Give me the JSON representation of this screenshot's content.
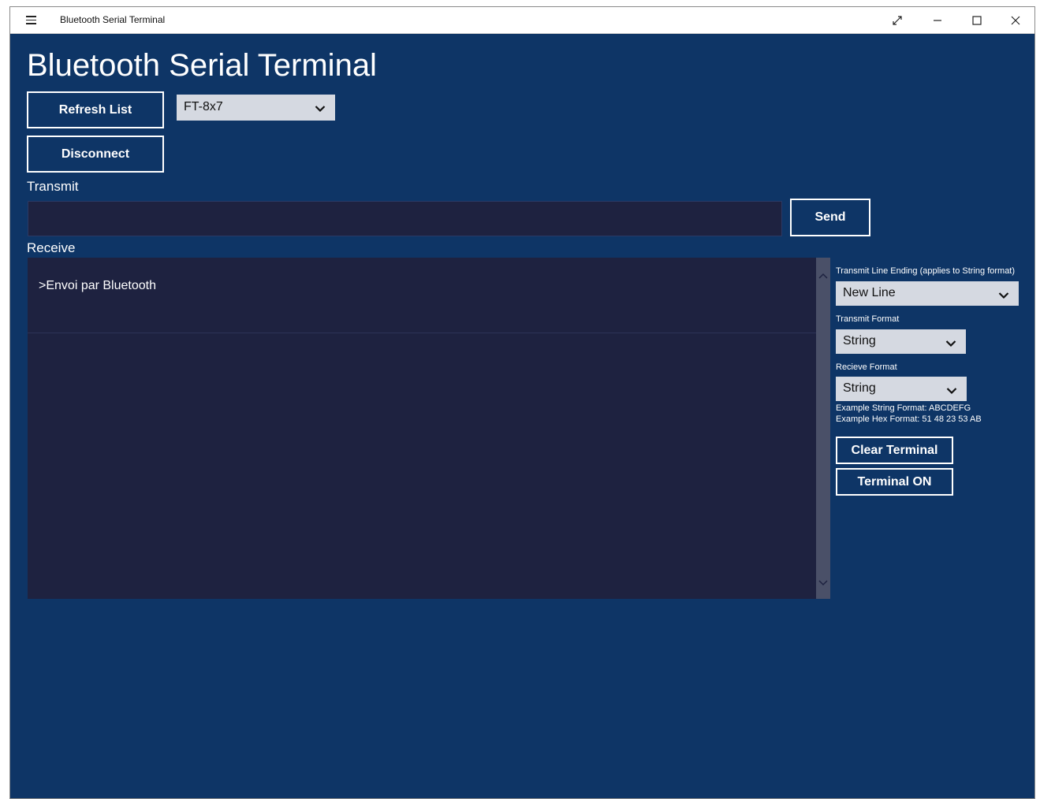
{
  "window": {
    "title": "Bluetooth Serial Terminal"
  },
  "app": {
    "heading": "Bluetooth Serial Terminal"
  },
  "device": {
    "refresh_label": "Refresh List",
    "disconnect_label": "Disconnect",
    "selected": "FT-8x7"
  },
  "transmit": {
    "label": "Transmit",
    "value": "",
    "send_label": "Send"
  },
  "receive": {
    "label": "Receive",
    "lines": [
      ">Envoi par Bluetooth"
    ]
  },
  "settings": {
    "line_ending_label": "Transmit Line Ending (applies to String format)",
    "line_ending_value": "New Line",
    "transmit_format_label": "Transmit Format",
    "transmit_format_value": "String",
    "receive_format_label": "Recieve Format",
    "receive_format_value": "String",
    "example_string": "Example String Format: ABCDEFG",
    "example_hex": "Example Hex Format: 51 48 23 53 AB",
    "clear_label": "Clear Terminal",
    "terminal_label": "Terminal ON"
  },
  "colors": {
    "background": "#0e3566",
    "panel": "#1e2240",
    "combo": "#d5d9e1",
    "scrollbar": "#4a5068"
  },
  "icons": {
    "menu": "hamburger-icon",
    "full_screen": "expand-icon",
    "minimize": "minimize-icon",
    "maximize": "maximize-icon",
    "close": "close-icon",
    "dropdown": "chevron-down-icon"
  }
}
